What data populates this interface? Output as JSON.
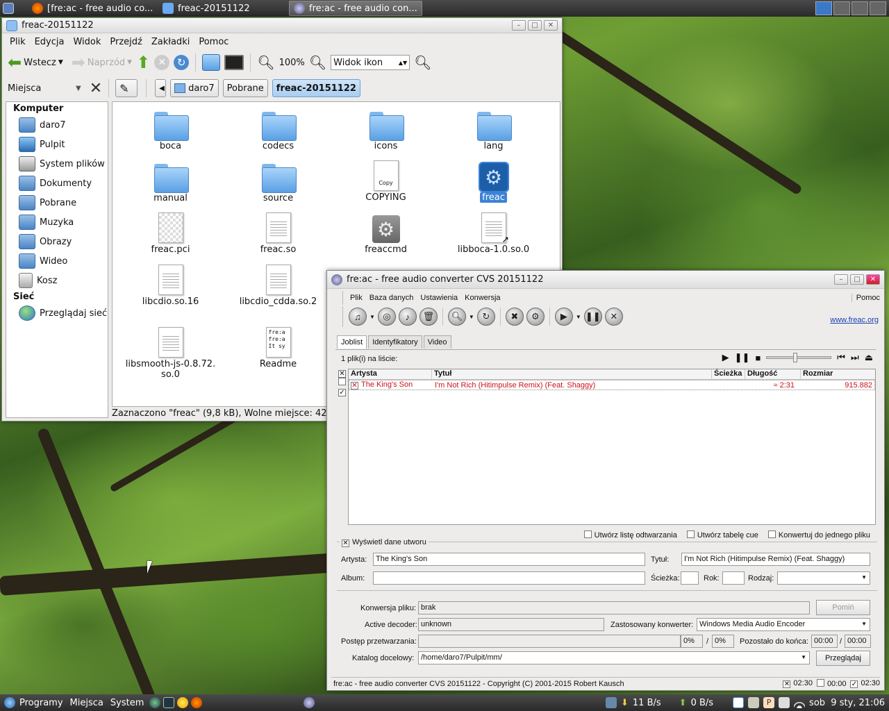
{
  "top_panel": {
    "tasks": [
      {
        "label": "[fre:ac - free audio co..."
      },
      {
        "label": "freac-20151122"
      },
      {
        "label": "fre:ac - free audio con..."
      }
    ]
  },
  "nautilus": {
    "title": "freac-20151122",
    "menu": [
      "Plik",
      "Edycja",
      "Widok",
      "Przejdź",
      "Zakładki",
      "Pomoc"
    ],
    "back_label": "Wstecz",
    "forward_label": "Naprzód",
    "zoom": "100%",
    "view_mode": "Widok ikon",
    "places_label": "Miejsca",
    "path": [
      "daro7",
      "Pobrane",
      "freac-20151122"
    ],
    "sidebar": {
      "computer_header": "Komputer",
      "items": [
        "daro7",
        "Pulpit",
        "System plików",
        "Dokumenty",
        "Pobrane",
        "Muzyka",
        "Obrazy",
        "Wideo",
        "Kosz"
      ],
      "network_header": "Sieć",
      "network_items": [
        "Przeglądaj sieć"
      ]
    },
    "files": [
      {
        "name": "boca",
        "type": "folder"
      },
      {
        "name": "codecs",
        "type": "folder"
      },
      {
        "name": "icons",
        "type": "folder"
      },
      {
        "name": "lang",
        "type": "folder"
      },
      {
        "name": "manual",
        "type": "folder"
      },
      {
        "name": "source",
        "type": "folder"
      },
      {
        "name": "COPYING",
        "type": "text"
      },
      {
        "name": "freac",
        "type": "exec",
        "selected": true
      },
      {
        "name": "freac.pci",
        "type": "pci"
      },
      {
        "name": "freac.so",
        "type": "text"
      },
      {
        "name": "freaccmd",
        "type": "exec"
      },
      {
        "name": "libboca-1.0.so.0",
        "type": "link"
      },
      {
        "name": "libcdio.so.16",
        "type": "text"
      },
      {
        "name": "libcdio_cdda.so.2",
        "type": "text"
      },
      {
        "name": "libsmooth-js-0.8.72.\nso.0",
        "type": "text"
      },
      {
        "name": "Readme",
        "type": "readme"
      }
    ],
    "copy_badge": "Copy",
    "readme_preview": "fre:a\nfre:a\nIt sy",
    "status": "Zaznaczono \"freac\" (9,8 kB), Wolne miejsce: 42"
  },
  "freac": {
    "title": "fre:ac - free audio converter CVS 20151122",
    "menu": [
      "Plik",
      "Baza danych",
      "Ustawienia",
      "Konwersja"
    ],
    "help": "Pomoc",
    "link": "www.freac.org",
    "tabs": [
      "Joblist",
      "Identyfikatory",
      "Video"
    ],
    "files_count": "1 plik(i) na liście:",
    "columns": [
      "Artysta",
      "Tytuł",
      "Ścieżka",
      "Długość",
      "Rozmiar"
    ],
    "rows": [
      {
        "artist": "The King's Son",
        "title": "I'm Not Rich (Hitimpulse Remix) (Feat. Shaggy)",
        "track": "",
        "length": "≈ 2:31",
        "size": "915.882"
      }
    ],
    "opt_playlist": "Utwórz listę odtwarzania",
    "opt_cue": "Utwórz tabelę cue",
    "opt_single": "Konwertuj do jednego pliku",
    "show_info": "Wyświetl dane utworu",
    "artist_label": "Artysta:",
    "artist": "The King's Son",
    "title_label": "Tytuł:",
    "track_title": "I'm Not Rich (Hitimpulse Remix) (Feat. Shaggy)",
    "album_label": "Album:",
    "track_label": "Ścieżka:",
    "year_label": "Rok:",
    "genre_label": "Rodzaj:",
    "conv_label": "Konwersja pliku:",
    "conv_value": "brak",
    "skip_btn": "Pomiń",
    "decoder_label": "Active decoder:",
    "decoder_value": "unknown",
    "encoder_label": "Zastosowany konwerter:",
    "encoder_value": "Windows Media Audio Encoder",
    "progress_label": "Postęp przetwarzania:",
    "progress_file": "0%",
    "slash": "/",
    "progress_total": "0%",
    "remaining_label": "Pozostało do końca:",
    "remaining_file": "00:00",
    "remaining_total": "00:00",
    "dir_label": "Katalog docelowy:",
    "dir_value": "/home/daro7/Pulpit/mm/",
    "browse_btn": "Przeglądaj",
    "statusbar": "fre:ac - free audio converter CVS 20151122 - Copyright (C) 2001-2015 Robert Kausch",
    "time1": "02:30",
    "time2": "00:00",
    "time3": "02:30"
  },
  "bottom_panel": {
    "menu": [
      "Programy",
      "Miejsca",
      "System"
    ],
    "down_rate": "11 B/s",
    "up_rate": "0 B/s",
    "clock": "sob  9 sty, 21:06"
  }
}
